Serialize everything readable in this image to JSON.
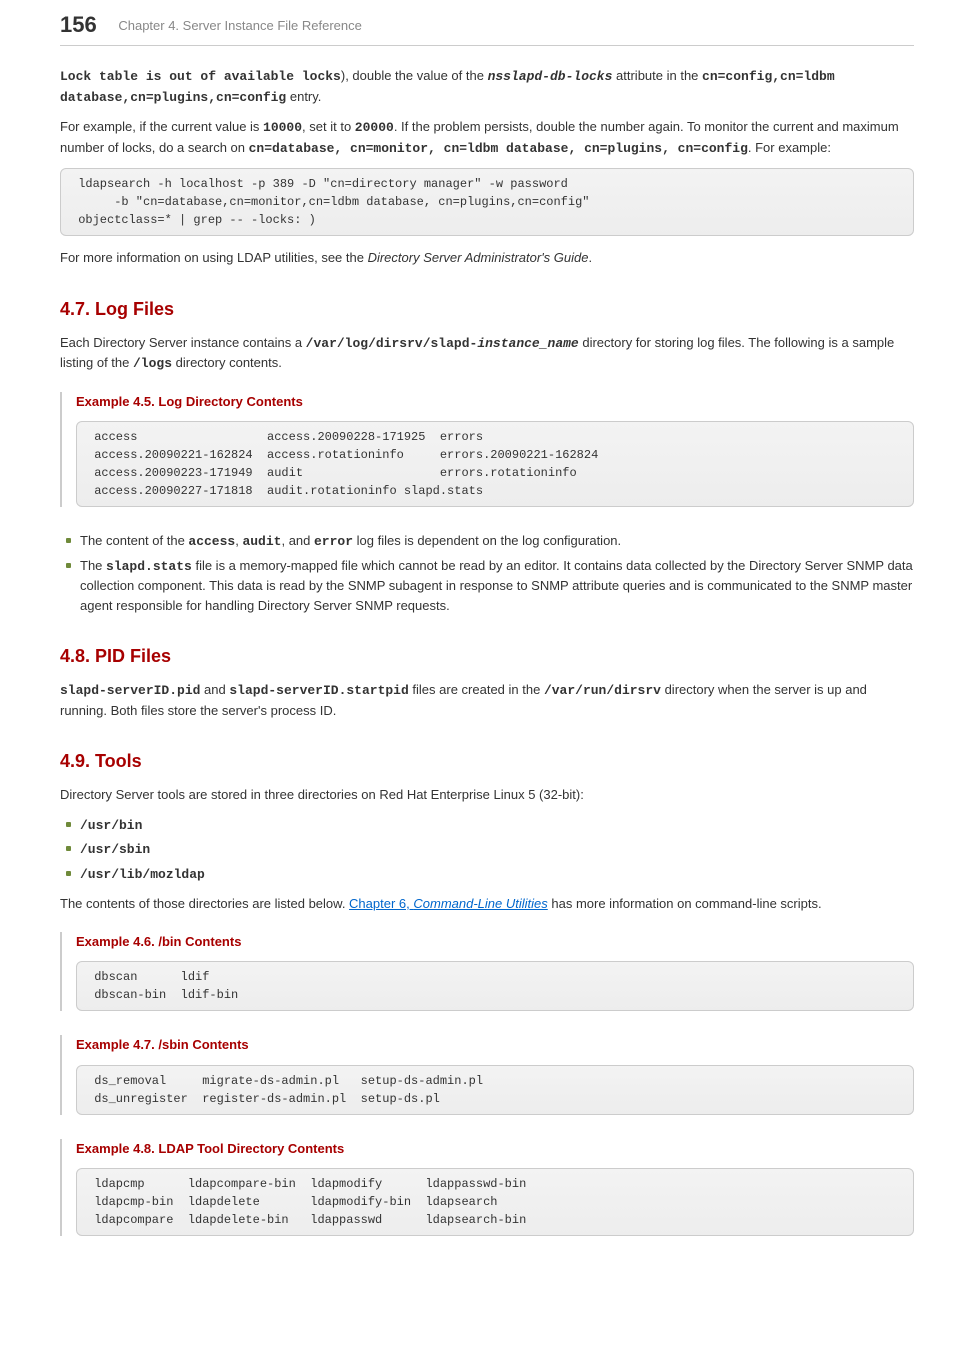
{
  "header": {
    "page_number": "156",
    "chapter": "Chapter 4. Server Instance File Reference"
  },
  "intro": {
    "lock_msg": "Lock table is out of available locks",
    "p1_mid": "), double the value of the ",
    "attr_name": "nsslapd-db-locks",
    "p1_tail": " attribute in the ",
    "dn1": "cn=config,cn=ldbm database,cn=plugins,cn=config",
    "p1_end": " entry.",
    "p2_a": "For example, if the current value is ",
    "v1": "10000",
    "p2_b": ", set it to ",
    "v2": "20000",
    "p2_c": ". If the problem persists, double the number again. To monitor the current and maximum number of locks, do a search on ",
    "dn2": "cn=database, cn=monitor, cn=ldbm database, cn=plugins, cn=config",
    "p2_d": ". For example:",
    "code1": " ldapsearch -h localhost -p 389 -D \"cn=directory manager\" -w password\n      -b \"cn=database,cn=monitor,cn=ldbm database, cn=plugins,cn=config\"\n objectclass=* | grep -- -locks: )",
    "p3_a": "For more information on using LDAP utilities, see the ",
    "guide": "Directory Server Administrator's Guide",
    "p3_b": "."
  },
  "s47": {
    "heading": "4.7. Log Files",
    "p1_a": "Each Directory Server instance contains a ",
    "path_a": "/var/log/dirsrv/slapd-",
    "path_b": "instance_name",
    "p1_b": " directory for storing log files. The following is a sample listing of the ",
    "logs": "/logs",
    "p1_c": " directory contents.",
    "example_title": "Example 4.5. Log Directory Contents",
    "example_code": " access                  access.20090228-171925  errors\n access.20090221-162824  access.rotationinfo     errors.20090221-162824\n access.20090223-171949  audit                   errors.rotationinfo\n access.20090227-171818  audit.rotationinfo slapd.stats",
    "li1_a": "The content of the ",
    "li1_access": "access",
    "li1_b": ", ",
    "li1_audit": "audit",
    "li1_c": ", and ",
    "li1_error": "error",
    "li1_d": " log files is dependent on the log configuration.",
    "li2_a": "The ",
    "li2_stats": "slapd.stats",
    "li2_b": " file is a memory-mapped file which cannot be read by an editor. It contains data collected by the Directory Server SNMP data collection component. This data is read by the SNMP subagent in response to SNMP attribute queries and is communicated to the SNMP master agent responsible for handling Directory Server SNMP requests."
  },
  "s48": {
    "heading": "4.8. PID Files",
    "pid1": "slapd-serverID.pid",
    "and": " and ",
    "pid2": "slapd-serverID.startpid",
    "p_a": " files are created in the ",
    "dir": "/var/run/dirsrv",
    "p_b": " directory when the server is up and running. Both files store the server's process ID."
  },
  "s49": {
    "heading": "4.9. Tools",
    "p1": "Directory Server tools are stored in three directories on Red Hat Enterprise Linux 5 (32-bit):",
    "dirs": [
      "/usr/bin",
      "/usr/sbin",
      "/usr/lib/mozldap"
    ],
    "p2_a": "The contents of those directories are listed below. ",
    "link_a": "Chapter 6, ",
    "link_b": "Command-Line Utilities",
    "p2_b": " has more information on command-line scripts.",
    "ex46_title": "Example 4.6. /bin Contents",
    "ex46_code": " dbscan      ldif\n dbscan-bin  ldif-bin",
    "ex47_title": "Example 4.7. /sbin Contents",
    "ex47_code": " ds_removal     migrate-ds-admin.pl   setup-ds-admin.pl\n ds_unregister  register-ds-admin.pl  setup-ds.pl",
    "ex48_title": "Example 4.8. LDAP Tool Directory Contents",
    "ex48_code": " ldapcmp      ldapcompare-bin  ldapmodify      ldappasswd-bin\n ldapcmp-bin  ldapdelete       ldapmodify-bin  ldapsearch\n ldapcompare  ldapdelete-bin   ldappasswd      ldapsearch-bin"
  }
}
